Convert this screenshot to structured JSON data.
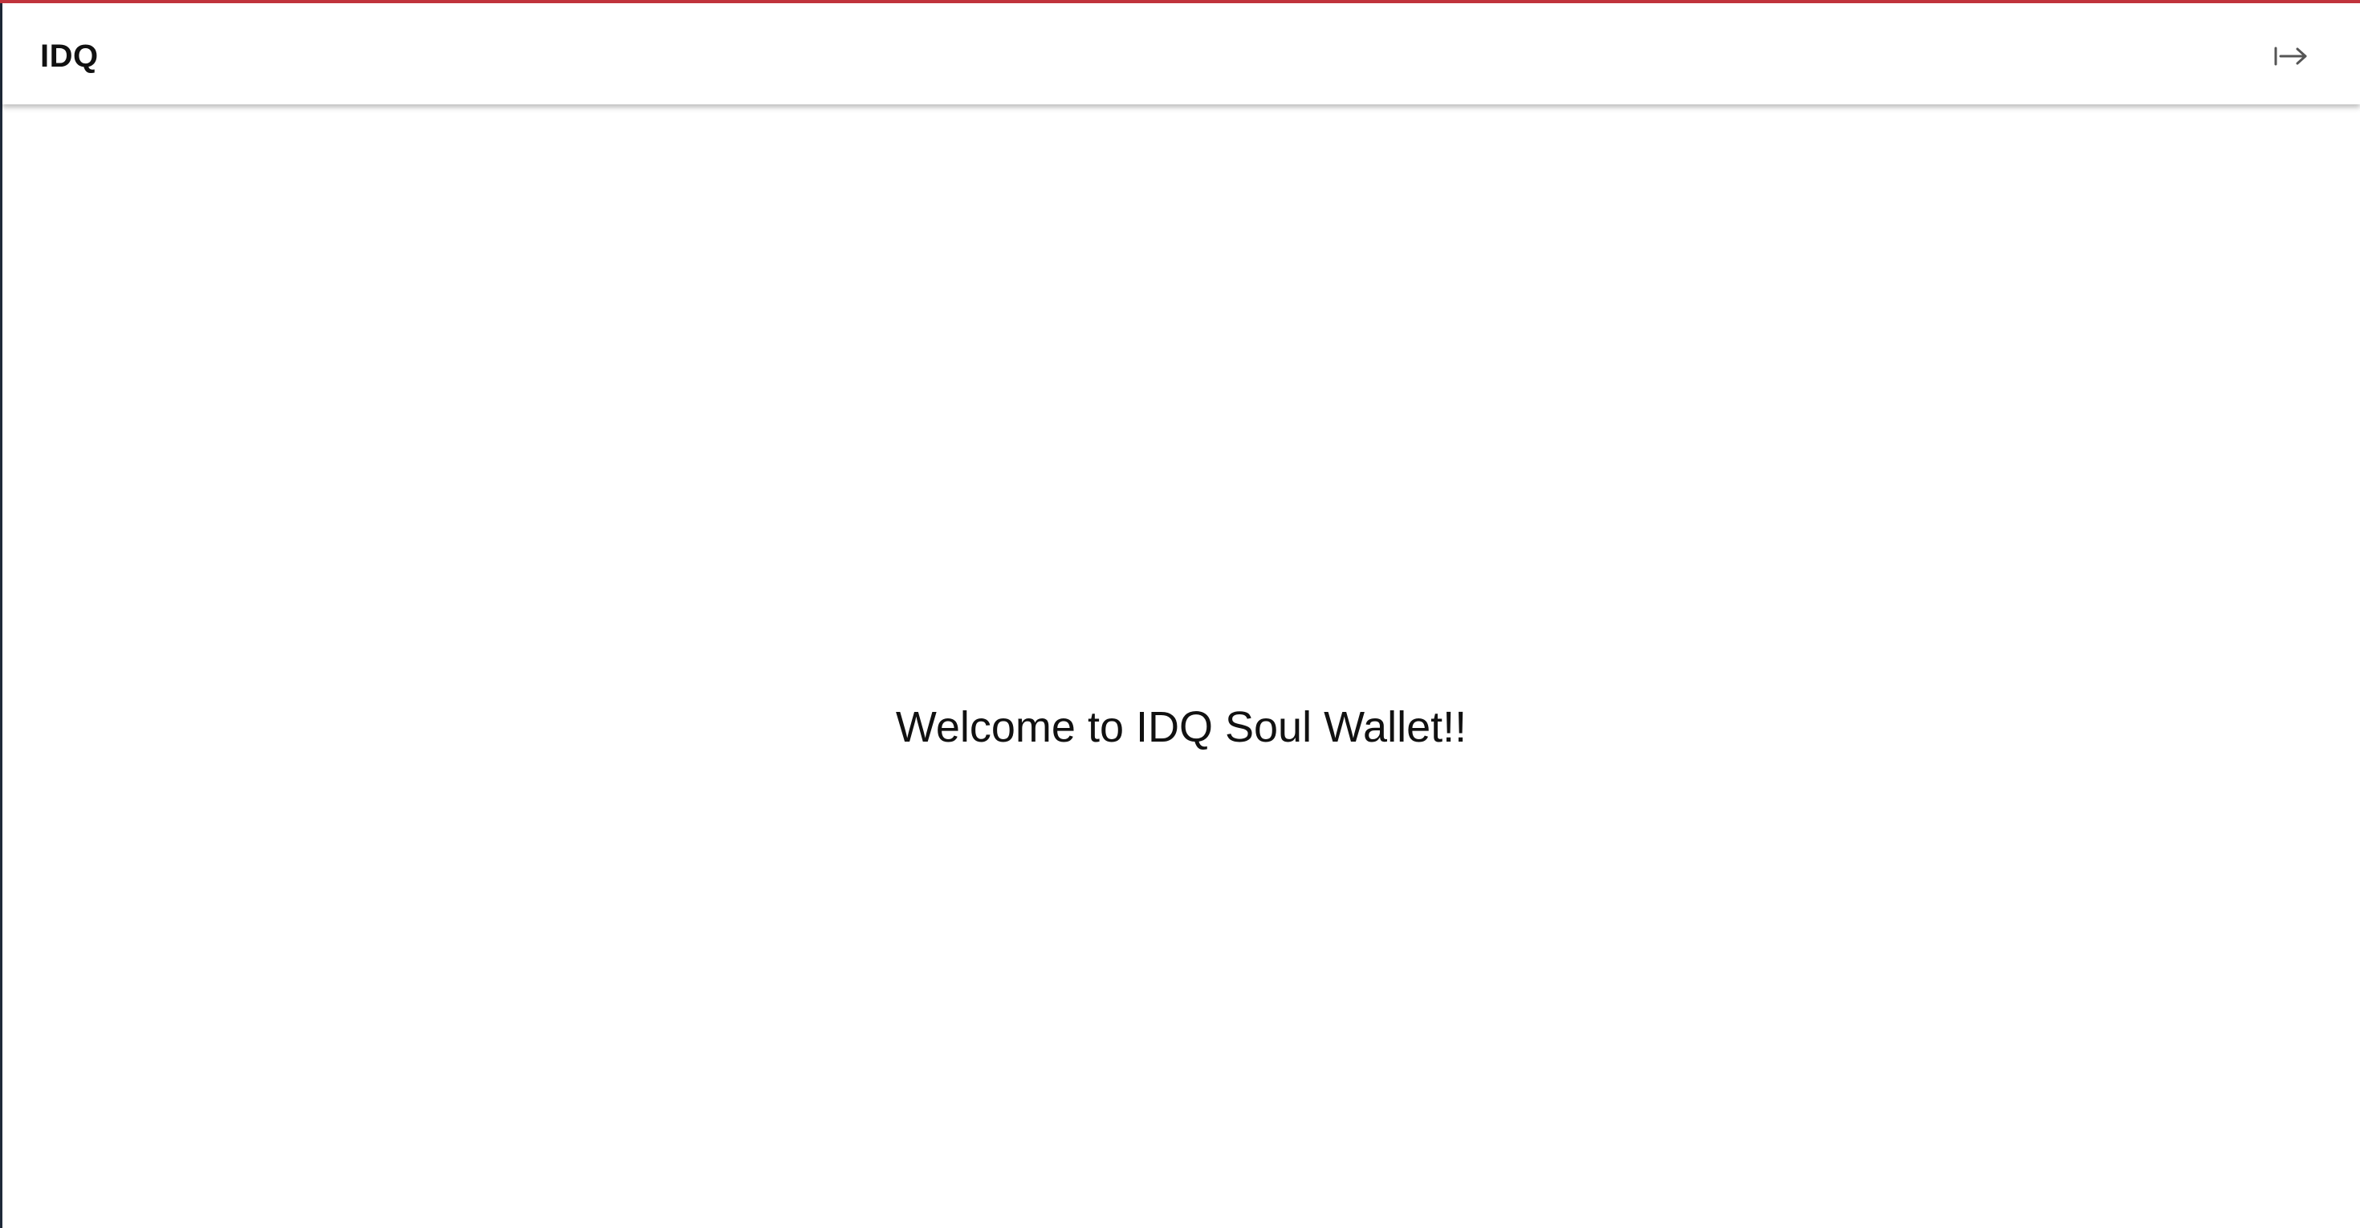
{
  "header": {
    "brand": "IDQ",
    "logout_icon": "logout-arrow-icon"
  },
  "main": {
    "welcome_text": "Welcome to IDQ Soul Wallet!!"
  },
  "colors": {
    "accent_top": "#c0343c",
    "text": "#111111",
    "icon": "#555555"
  }
}
